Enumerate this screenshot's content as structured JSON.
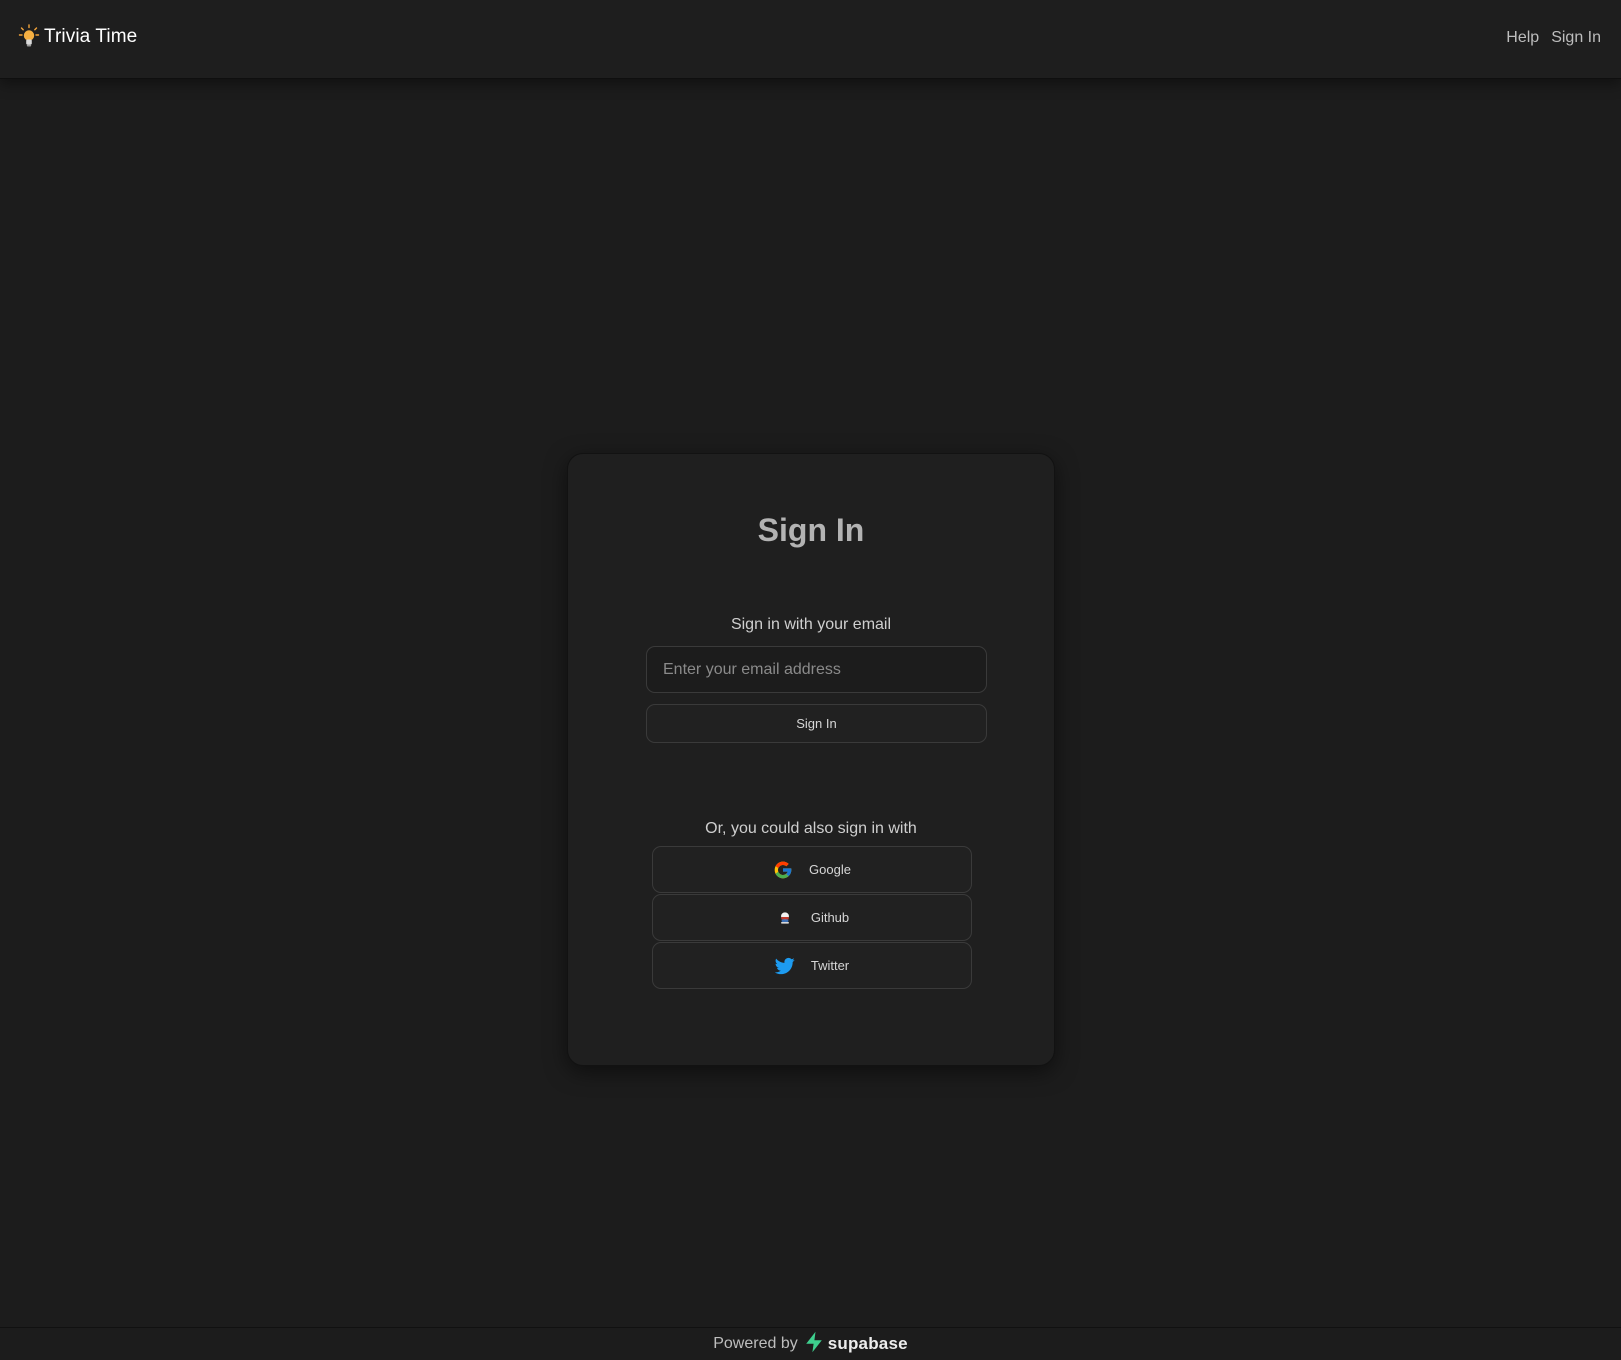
{
  "header": {
    "app_title": "Trivia Time",
    "logo_icon": "lightbulb-icon",
    "nav": [
      {
        "label": "Help"
      },
      {
        "label": "Sign In"
      }
    ]
  },
  "card": {
    "title": "Sign In",
    "email_section_label": "Sign in with your email",
    "email_input": {
      "value": "",
      "placeholder": "Enter your email address"
    },
    "submit_label": "Sign In",
    "oauth_section_label": "Or, you could also sign in with",
    "providers": [
      {
        "label": "Google",
        "icon": "google-icon"
      },
      {
        "label": "Github",
        "icon": "github-icon"
      },
      {
        "label": "Twitter",
        "icon": "twitter-icon",
        "color": "#1d9bf0"
      }
    ]
  },
  "footer": {
    "powered_by": "Powered by",
    "brand_name": "supabase",
    "brand_color": "#3ecf8e"
  },
  "colors": {
    "background": "#1c1c1c",
    "card_background": "#1f1f1f",
    "border": "#3a3a3a"
  }
}
